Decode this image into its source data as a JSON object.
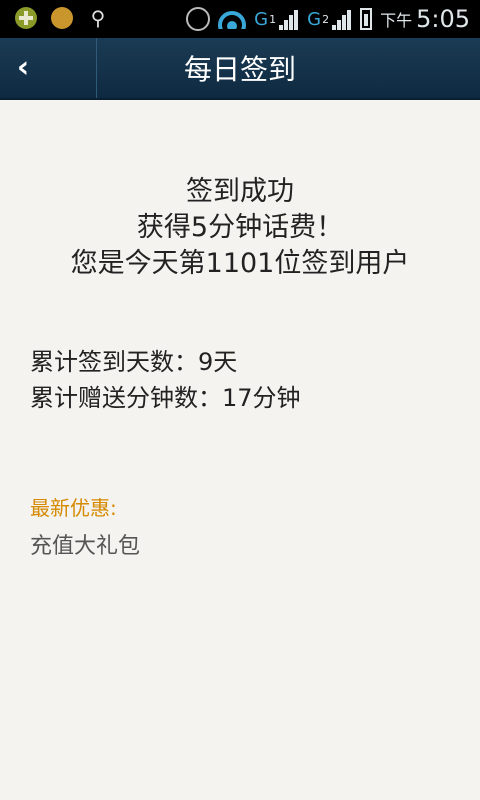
{
  "status_bar": {
    "ampm": "下午",
    "time": "5:05",
    "network1_label": "G",
    "network1_sim": "1",
    "network2_label": "G",
    "network2_sim": "2",
    "icons": [
      "notification-green-icon",
      "notification-amber-icon",
      "usb-icon",
      "alarm-icon",
      "wifi-icon",
      "signal-icon",
      "battery-icon"
    ]
  },
  "header": {
    "title": "每日签到",
    "back_icon": "chevron-left-icon"
  },
  "result": {
    "line1": "签到成功",
    "line2": "获得5分钟话费！",
    "line3": "您是今天第1101位签到用户"
  },
  "stats": {
    "days_line": "累计签到天数：9天",
    "minutes_line": "累计赠送分钟数：17分钟"
  },
  "promo": {
    "title": "最新优惠:",
    "item": "充值大礼包"
  },
  "colors": {
    "header_bg": "#14344c",
    "promo_title": "#d58a00",
    "background": "#f4f3ef"
  }
}
